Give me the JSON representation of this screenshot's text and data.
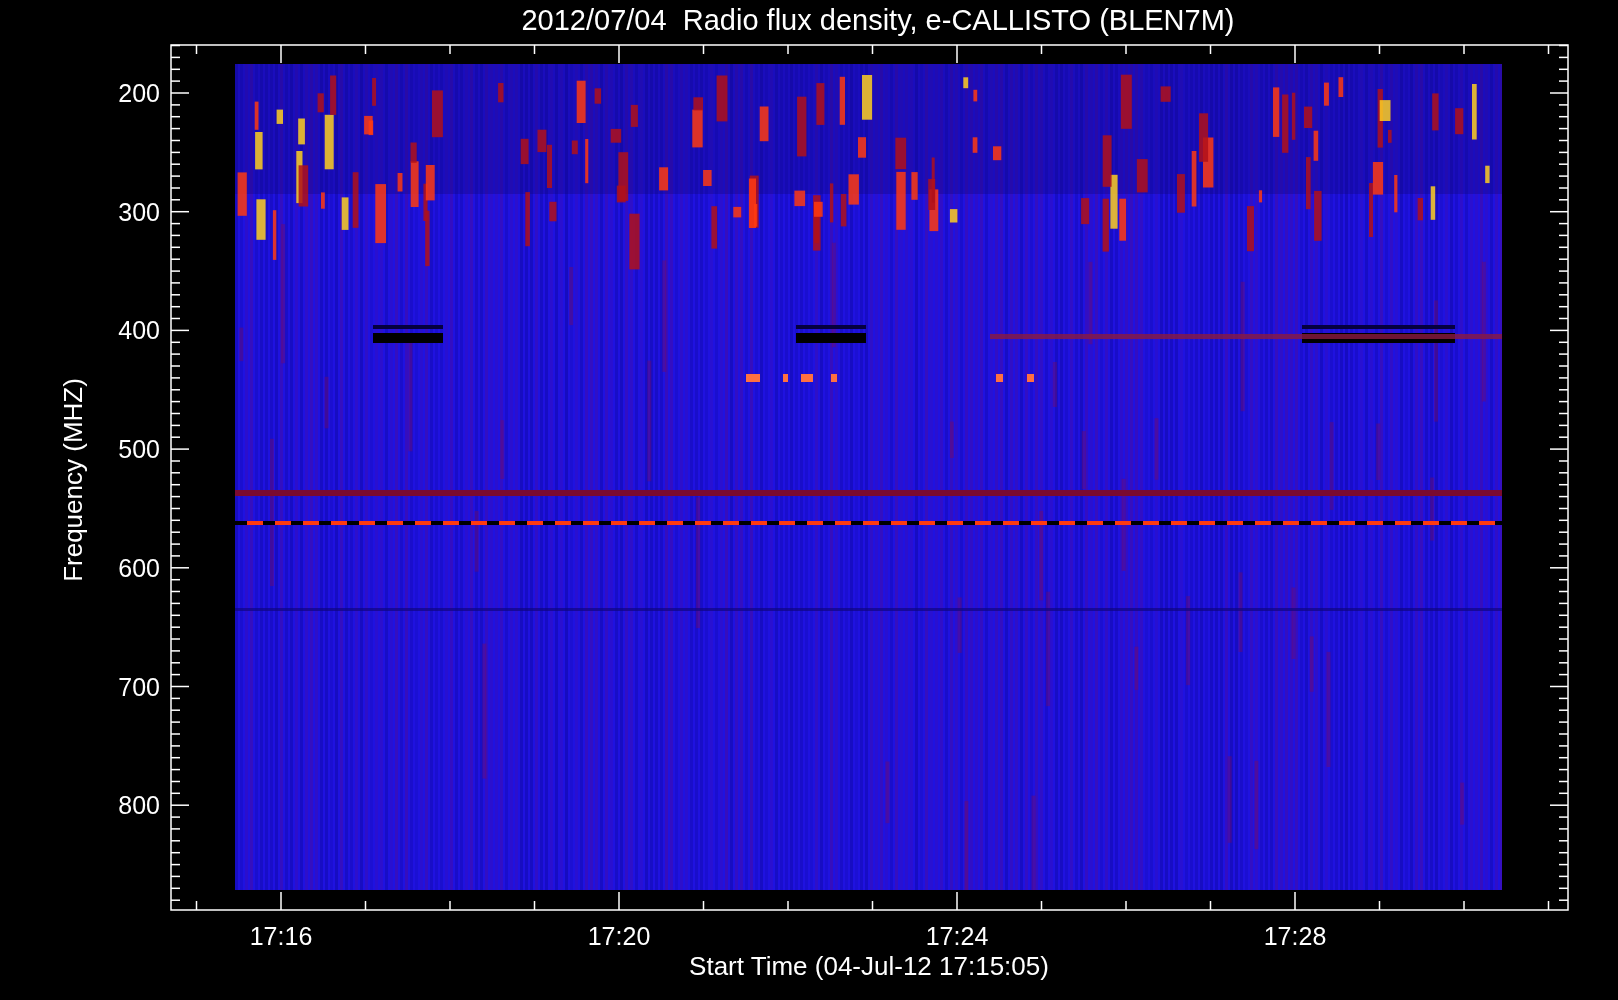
{
  "title": "2012/07/04  Radio flux density, e-CALLISTO (BLEN7M)",
  "ylabel": "Frequency (MHZ)",
  "xlabel": "Start Time (04-Jul-12 17:15:05)",
  "yticks": [
    "200",
    "300",
    "400",
    "500",
    "600",
    "700",
    "800"
  ],
  "xticks": [
    "17:16",
    "17:20",
    "17:24",
    "17:28"
  ]
}
